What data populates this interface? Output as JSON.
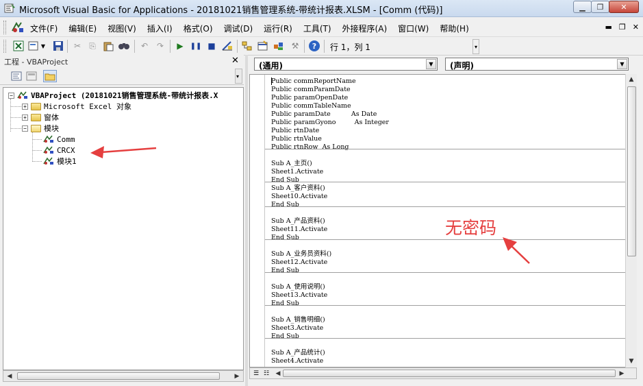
{
  "window": {
    "title": "Microsoft Visual Basic for Applications - 20181021销售管理系统-带统计报表.XLSM - [Comm (代码)]",
    "minimize_icon": "minimize-icon",
    "restore_icon": "restore-icon",
    "close_icon": "close-icon"
  },
  "menubar": {
    "items": [
      {
        "label": "文件(F)"
      },
      {
        "label": "编辑(E)"
      },
      {
        "label": "视图(V)"
      },
      {
        "label": "插入(I)"
      },
      {
        "label": "格式(O)"
      },
      {
        "label": "调试(D)"
      },
      {
        "label": "运行(R)"
      },
      {
        "label": "工具(T)"
      },
      {
        "label": "外接程序(A)"
      },
      {
        "label": "窗口(W)"
      },
      {
        "label": "帮助(H)"
      }
    ]
  },
  "toolbar": {
    "cursor_position": "行 1，列 1"
  },
  "project_pane": {
    "title": "工程 - VBAProject",
    "tree": {
      "root": "VBAProject (20181021销售管理系统-带统计报表.X",
      "nodes": [
        {
          "label": "Microsoft Excel 对象"
        },
        {
          "label": "窗体"
        },
        {
          "label": "模块"
        }
      ],
      "modules": [
        {
          "label": "Comm"
        },
        {
          "label": "CRCX"
        },
        {
          "label": "模块1"
        }
      ]
    }
  },
  "code_pane": {
    "object_combo": "(通用)",
    "procedure_combo": "(声明)",
    "lines": [
      "Public commReportName",
      "Public commParamDate",
      "Public paramOpenDate",
      "Public commTableName",
      "Public paramDate          As Date",
      "Public paramGyono         As Integer",
      "Public rtnDate",
      "Public rtnValue",
      "Public rtnRow  As Long",
      "Sub A_主页()",
      "Sheet1.Activate",
      "End Sub",
      "Sub A_客户资料()",
      "Sheet10.Activate",
      "End Sub",
      "Sub A_产品资料()",
      "Sheet11.Activate",
      "End Sub",
      "Sub A_业务员资料()",
      "Sheet12.Activate",
      "End Sub",
      "Sub A_使用说明()",
      "Sheet13.Activate",
      "End Sub",
      "Sub A_销售明细()",
      "Sheet3.Activate",
      "End Sub",
      "Sub A_产品统计()",
      "Sheet4.Activate"
    ]
  },
  "annotation": {
    "text": "无密码",
    "color": "#e53f3f"
  }
}
